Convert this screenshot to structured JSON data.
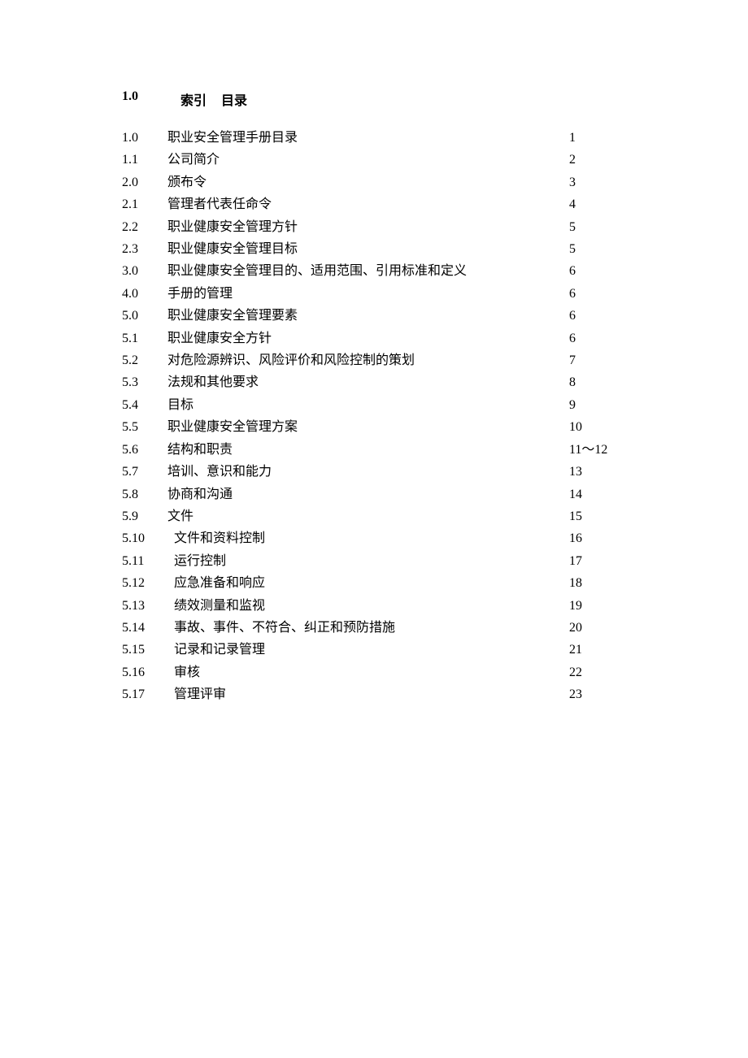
{
  "header": {
    "num": "1.0",
    "label_part1": "索引",
    "label_part2": "目录"
  },
  "entries": [
    {
      "num": "1.0",
      "title": "职业安全管理手册目录",
      "page": "1",
      "indent": false
    },
    {
      "num": "1.1",
      "title": "公司简介",
      "page": "2",
      "indent": false
    },
    {
      "num": "2.0",
      "title": "颁布令",
      "page": "3",
      "indent": false
    },
    {
      "num": "2.1",
      "title": "管理者代表任命令",
      "page": "4",
      "indent": false
    },
    {
      "num": "2.2",
      "title": "职业健康安全管理方针",
      "page": "5",
      "indent": false
    },
    {
      "num": "2.3",
      "title": "职业健康安全管理目标",
      "page": "5",
      "indent": false
    },
    {
      "num": "3.0",
      "title": "职业健康安全管理目的、适用范围、引用标准和定义",
      "page": "6",
      "indent": false
    },
    {
      "num": "4.0",
      "title": "手册的管理",
      "page": "6",
      "indent": false
    },
    {
      "num": "5.0",
      "title": "职业健康安全管理要素",
      "page": "6",
      "indent": false
    },
    {
      "num": "5.1",
      "title": "职业健康安全方针",
      "page": "6",
      "indent": false
    },
    {
      "num": "5.2",
      "title": "对危险源辨识、风险评价和风险控制的策划",
      "page": "7",
      "indent": false
    },
    {
      "num": "5.3",
      "title": "法规和其他要求",
      "page": "8",
      "indent": false
    },
    {
      "num": "5.4",
      "title": "目标",
      "page": "9",
      "indent": false
    },
    {
      "num": "5.5",
      "title": "职业健康安全管理方案",
      "page": "10",
      "indent": false
    },
    {
      "num": "5.6",
      "title": "结构和职责",
      "page": "11～12",
      "indent": false
    },
    {
      "num": "5.7",
      "title": "培训、意识和能力",
      "page": "13",
      "indent": false
    },
    {
      "num": "5.8",
      "title": "协商和沟通",
      "page": "14",
      "indent": false
    },
    {
      "num": "5.9",
      "title": "文件",
      "page": "15",
      "indent": false
    },
    {
      "num": "5.10",
      "title": "文件和资料控制",
      "page": "16",
      "indent": true
    },
    {
      "num": "5.11",
      "title": "运行控制",
      "page": "17",
      "indent": true
    },
    {
      "num": "5.12",
      "title": "应急准备和响应",
      "page": "18",
      "indent": true
    },
    {
      "num": "5.13",
      "title": "绩效测量和监视",
      "page": "19",
      "indent": true
    },
    {
      "num": "5.14",
      "title": "事故、事件、不符合、纠正和预防措施",
      "page": "20",
      "indent": true
    },
    {
      "num": "5.15",
      "title": "记录和记录管理",
      "page": "21",
      "indent": true
    },
    {
      "num": "5.16",
      "title": "审核",
      "page": "22",
      "indent": true
    },
    {
      "num": "5.17",
      "title": "管理评审",
      "page": "23",
      "indent": true
    }
  ]
}
